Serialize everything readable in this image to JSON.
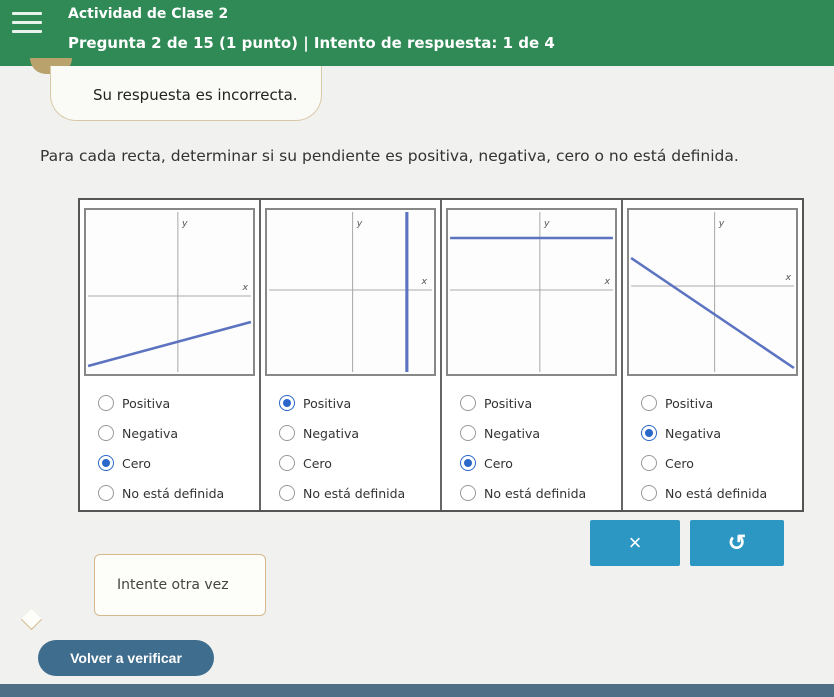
{
  "header": {
    "course_title": "Actividad de Clase 2",
    "question_info": "Pregunta 2 de 15 (1 punto)  |  Intento de respuesta: 1 de 4",
    "menu_icon": "hamburger-menu-icon",
    "background_color": "#2f8a55"
  },
  "feedback": {
    "message": "Su respuesta es incorrecta."
  },
  "instruction": "Para cada recta, determinar si su pendiente es positiva, negativa, cero o no está definida.",
  "graphs": [
    {
      "x_label": "x",
      "y_label": "y",
      "line": "positive-slope"
    },
    {
      "x_label": "x",
      "y_label": "y",
      "line": "vertical"
    },
    {
      "x_label": "x",
      "y_label": "y",
      "line": "horizontal"
    },
    {
      "x_label": "x",
      "y_label": "y",
      "line": "negative-slope"
    }
  ],
  "options": [
    "Positiva",
    "Negativa",
    "Cero",
    "No está definida"
  ],
  "selected": [
    "Cero",
    "Positiva",
    "Cero",
    "Negativa"
  ],
  "buttons": {
    "clear_symbol": "×",
    "retry_symbol": "↺",
    "recheck_label": "Volver a verificar"
  },
  "hint": {
    "text": "Intente otra vez"
  },
  "colors": {
    "accent": "#2d97c4",
    "line": "#5b73c0",
    "radio_selected": "#2a67c9"
  }
}
